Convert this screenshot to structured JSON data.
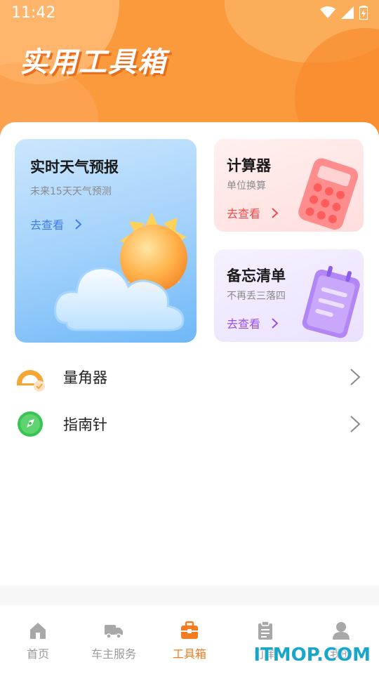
{
  "status_bar": {
    "time": "11:42"
  },
  "header": {
    "title": "实用工具箱"
  },
  "cards": {
    "weather": {
      "title": "实时天气预报",
      "subtitle": "未来15天天气预测",
      "link": "去查看",
      "link_color": "#3f7ee8"
    },
    "calculator": {
      "title": "计算器",
      "subtitle": "单位换算",
      "link": "去查看",
      "link_color": "#f24a4a"
    },
    "memo": {
      "title": "备忘清单",
      "subtitle": "不再丢三落四",
      "link": "去查看",
      "link_color": "#9b4ee6"
    }
  },
  "tools": [
    {
      "label": "量角器",
      "icon": "protractor-icon"
    },
    {
      "label": "指南针",
      "icon": "compass-icon"
    }
  ],
  "bottom_nav": [
    {
      "label": "首页",
      "icon": "home-icon",
      "active": false
    },
    {
      "label": "车主服务",
      "icon": "truck-icon",
      "active": false
    },
    {
      "label": "工具箱",
      "icon": "toolbox-icon",
      "active": true
    },
    {
      "label": "订单",
      "icon": "clipboard-icon",
      "active": false
    },
    {
      "label": "我的",
      "icon": "user-icon",
      "active": false
    }
  ],
  "watermark": "ITMOP.COM",
  "colors": {
    "accent": "#f47b20",
    "header": "#fb9a3c",
    "inactive": "#9a9a9a"
  }
}
